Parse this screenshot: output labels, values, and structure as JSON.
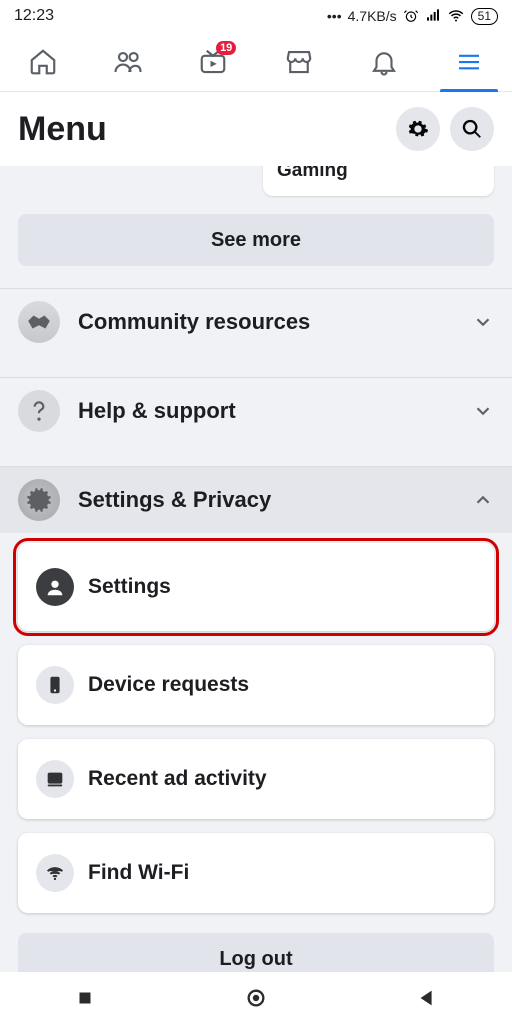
{
  "status": {
    "time": "12:23",
    "net_speed": "4.7KB/s",
    "battery": "51"
  },
  "tabs": {
    "watch_badge": "19"
  },
  "header": {
    "title": "Menu"
  },
  "shortcuts": {
    "gaming": "Gaming"
  },
  "see_more": "See more",
  "sections": {
    "community": "Community resources",
    "help": "Help & support",
    "settings_privacy": "Settings & Privacy"
  },
  "settings_items": {
    "settings": "Settings",
    "device_requests": "Device requests",
    "recent_ads": "Recent ad activity",
    "find_wifi": "Find Wi-Fi"
  },
  "logout": "Log out"
}
